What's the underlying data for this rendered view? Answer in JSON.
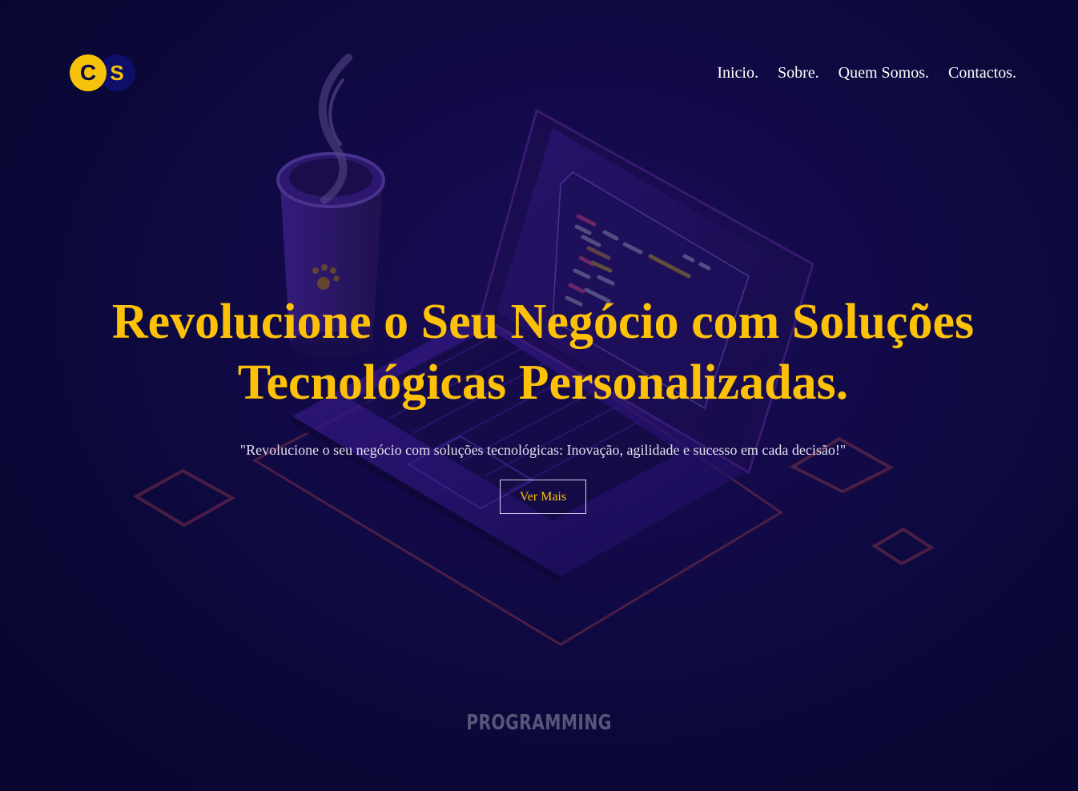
{
  "logo": {
    "letter_left": "C",
    "letter_right": "S",
    "primary_color": "#f7c20a",
    "secondary_color": "#0e0f6b"
  },
  "nav": {
    "items": [
      "Inicio.",
      "Sobre.",
      "Quem Somos.",
      "Contactos."
    ]
  },
  "hero": {
    "title": "Revolucione o Seu Negócio com Soluções Tecnológicas Personalizadas.",
    "subtitle": "\"Revolucione o seu negócio com soluções tecnológicas: Inovação, agilidade e sucesso em cada decisão!\"",
    "cta_label": "Ver Mais",
    "title_color": "#fdc207"
  },
  "background": {
    "illustration": "isometric-laptop-and-coffee-cup",
    "watermark": "PROGRAMMING",
    "base_color": "#0b0738"
  }
}
